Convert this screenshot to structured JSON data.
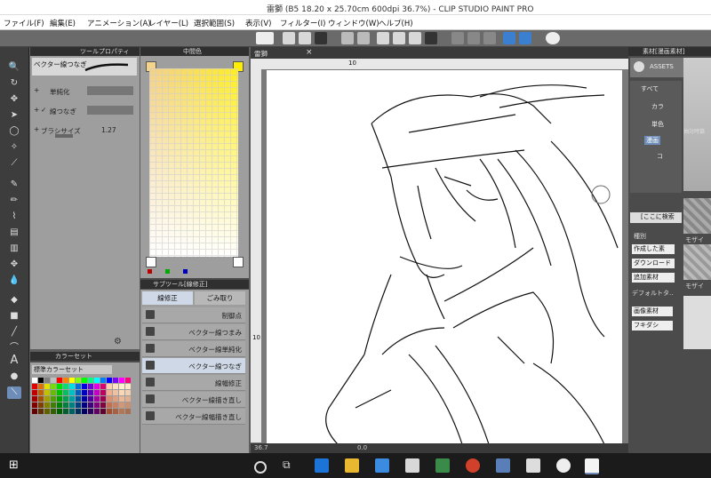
{
  "window": {
    "title": "雷獅 (B5 18.20 x 25.70cm 600dpi 36.7%) - CLIP STUDIO PAINT PRO"
  },
  "menu": [
    "ファイル(F)",
    "編集(E)",
    "アニメーション(A)",
    "レイヤー(L)",
    "選択範囲(S)",
    "表示(V)",
    "フィルター(I)",
    "ウィンドウ(W)",
    "ヘルプ(H)"
  ],
  "tool_property": {
    "tab_label": "ツールプロパティ",
    "brush_name": "ベクター線つなぎ",
    "rows": [
      {
        "label": "単純化"
      },
      {
        "label": "線つなぎ"
      },
      {
        "label": "ブラシサイズ",
        "value": "1.27"
      }
    ]
  },
  "color_picker": {
    "tab_label": "中間色"
  },
  "color_set": {
    "tab_label": "カラーセット",
    "dropdown_value": "標準カラーセット",
    "swatches": [
      "#ffffff",
      "#000000",
      "#7f7f7f",
      "#c0c0c0",
      "#ff0000",
      "#ff7f00",
      "#ffff00",
      "#7fff00",
      "#00ff00",
      "#00ff7f",
      "#00ffff",
      "#007fff",
      "#0000ff",
      "#7f00ff",
      "#ff00ff",
      "#ff007f",
      "#e00000",
      "#e07000",
      "#e0e000",
      "#70e000",
      "#00e000",
      "#00e070",
      "#00e0e0",
      "#0070e0",
      "#0000e0",
      "#7000e0",
      "#e000e0",
      "#e00070",
      "#ffd0b0",
      "#ffe0c0",
      "#fff0d0",
      "#ffe8c8",
      "#c00000",
      "#c06000",
      "#c0c000",
      "#60c000",
      "#00c000",
      "#00c060",
      "#00c0c0",
      "#0060c0",
      "#0000c0",
      "#6000c0",
      "#c000c0",
      "#c00060",
      "#f0b090",
      "#f0c0a0",
      "#f8d8b8",
      "#f0d0b0",
      "#a00000",
      "#a05000",
      "#a0a000",
      "#50a000",
      "#00a000",
      "#00a050",
      "#00a0a0",
      "#0050a0",
      "#0000a0",
      "#5000a0",
      "#a000a0",
      "#a00050",
      "#d89070",
      "#e0a080",
      "#e8b898",
      "#e0b090",
      "#800000",
      "#804000",
      "#808000",
      "#408000",
      "#008000",
      "#008040",
      "#008080",
      "#004080",
      "#000080",
      "#400080",
      "#800080",
      "#800040",
      "#c07050",
      "#c88060",
      "#d09878",
      "#c89070",
      "#600000",
      "#603000",
      "#606000",
      "#306000",
      "#006000",
      "#006030",
      "#006060",
      "#003060",
      "#000060",
      "#300060",
      "#600060",
      "#600030",
      "#a05030",
      "#a86040",
      "#b07858",
      "#a87050"
    ]
  },
  "sub_tool": {
    "tab_label": "サブツール[線修正]",
    "group_tabs": [
      "線修正",
      "ごみ取り"
    ],
    "items": [
      {
        "label": "制御点"
      },
      {
        "label": "ベクター線つまみ"
      },
      {
        "label": "ベクター線単純化"
      },
      {
        "label": "ベクター線つなぎ"
      },
      {
        "label": "線幅修正"
      },
      {
        "label": "ベクター線描き直し"
      },
      {
        "label": "ベクター線幅描き直し"
      }
    ],
    "selected_index": 3
  },
  "canvas": {
    "tab_label": "雷獅",
    "ruler_mark_top": "10",
    "ruler_mark_left": "10",
    "zoom": "36.7",
    "rotation": "0.0"
  },
  "material_panel": {
    "tab_label": "素材[漫画素材]",
    "header": "ASSETS",
    "tree": [
      "すべて",
      "カラ",
      "単色",
      "漫画",
      "コ"
    ],
    "search_placeholder": "[ここに検索",
    "section_label": "種別",
    "filters": [
      "作成した素",
      "ダウンロード",
      "追加素材"
    ],
    "default_label": "デフォルトタ..",
    "tags": [
      "画像素材",
      "フキダシ"
    ],
    "side_labels": [
      "抽対時篇",
      "モザイ",
      "モザイ"
    ]
  },
  "colors": {
    "accent": "#6e8db8",
    "panel_dark": "#2f2f2f",
    "panel_mid": "#4b4b4b",
    "panel_light": "#9e9e9e",
    "selected_item": "#cfd8e6"
  }
}
